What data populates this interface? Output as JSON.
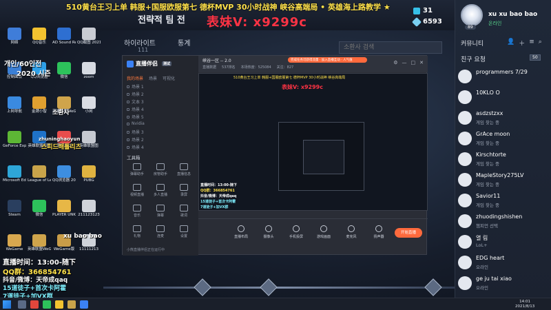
{
  "banner": {
    "text": "510黄台王习上单 韩服+国服欧服第七 德杯MVP 30小时战神 峡谷高端局 • 英雄海上路教学 ★",
    "sub": "전략적 팀 전",
    "watermark": "表妹V: x9299c",
    "stat_top": "31",
    "stat_bottom": "6593"
  },
  "game_nav": {
    "item1": "하이라이트",
    "item1_sub": "111",
    "item2": "통계"
  },
  "search": {
    "placeholder": "소환사 검색"
  },
  "desktop_icons": [
    {
      "label": "网络",
      "color": "#3f7dd9"
    },
    {
      "label": "QQ音乐",
      "color": "#f2c230"
    },
    {
      "label": "AD Sound Recorder",
      "color": "#2e6fd1"
    },
    {
      "label": "QQ截图 202108062...",
      "color": "#c9ccd3"
    },
    {
      "label": "控制面板",
      "color": "#3b7fd5"
    },
    {
      "label": "QQ浏览器",
      "color": "#2ea0e8"
    },
    {
      "label": "微信",
      "color": "#2dc25b"
    },
    {
      "label": "zoom",
      "color": "#d6dae2"
    },
    {
      "label": "上网导航",
      "color": "#3a8ae0"
    },
    {
      "label": "金牌小智",
      "color": "#e0a030"
    },
    {
      "label": "英雄联盟WeGame",
      "color": "#cfa44b"
    },
    {
      "label": "小闲",
      "color": "#d9dce3"
    },
    {
      "label": "GeForce Experience",
      "color": "#5db735"
    },
    {
      "label": "英雄联盟原图",
      "color": "#1f72c8"
    },
    {
      "label": "腾讯QQ",
      "color": "#e84d4d"
    },
    {
      "label": "英雄联盟图",
      "color": "#c5c9d1"
    },
    {
      "label": "Microsoft Edge",
      "color": "#2ea6d8"
    },
    {
      "label": "League of Legends",
      "color": "#c9a44a"
    },
    {
      "label": "QQ浏览器 2021071...",
      "color": "#3d8ee0"
    },
    {
      "label": "PUBG",
      "color": "#e0b340"
    },
    {
      "label": "Steam",
      "color": "#2a3f5f"
    },
    {
      "label": "微信",
      "color": "#2dc25b"
    },
    {
      "label": "PLAYER UNKNOWN'S BATTLEGR...",
      "color": "#e7b746"
    },
    {
      "label": "211123123",
      "color": "#cfd3da"
    },
    {
      "label": "WeGame",
      "color": "#d8a84f"
    },
    {
      "label": "英雄联盟WeGame版",
      "color": "#cfa44b"
    },
    {
      "label": "WeGame版",
      "color": "#c99d48"
    },
    {
      "label": "11111213",
      "color": "#cfd3da"
    }
  ],
  "overlay": {
    "line1": "개인/60인전",
    "line1_sub": "2020 시즌",
    "line2": "스피드배틀리츠",
    "line3": "소환사",
    "line4": "zhuninghaoyun",
    "line5": "xu bao bao",
    "live_time": "直播时间：13:00-随下",
    "qq_group": "QQ群：366854761",
    "douyin": "抖音/微博：天帝成qaq",
    "coach1": "15道徒子+首次卡阿霍",
    "coach2": "7道徒子+加VX群"
  },
  "profile": {
    "name": "xu xu bao bao",
    "status": "온라인",
    "level": "89"
  },
  "friends_panel": {
    "title": "커뮤니티",
    "section": "친구 요청",
    "count": "50",
    "friends": [
      {
        "name": "programmers 7/29",
        "status": ""
      },
      {
        "name": "10KLO O",
        "status": ""
      },
      {
        "name": "asdzstzxx",
        "status": "게임 찾는 중"
      },
      {
        "name": "GrAce moon",
        "status": "게임 찾는 중"
      },
      {
        "name": "Kirschtorte",
        "status": "게임 찾는 중"
      },
      {
        "name": "MapleStory275LV",
        "status": "게임 찾는 중"
      },
      {
        "name": "Savior11",
        "status": "게임 찾는 중"
      },
      {
        "name": "zhuodingshishen",
        "status": "챔피언 선택"
      },
      {
        "name": "열 림",
        "status": "LoL+"
      },
      {
        "name": "EDG heart",
        "status": "오라인"
      },
      {
        "name": "ge ju tai xiao",
        "status": "오라인"
      }
    ]
  },
  "app": {
    "logo": "直播伴侣",
    "logo_tag": "测试",
    "side_tabs": [
      "我的场景",
      "场景",
      "可视化"
    ],
    "scenes": [
      "场景 1",
      "场景 2",
      "文本 3",
      "场景 4",
      "场景 5",
      "Nvidia",
      "场景 3",
      "场景 2",
      "场景 4"
    ],
    "tools_title": "工具箱",
    "tools": [
      {
        "label": "弹幕助手"
      },
      {
        "label": "房管助手"
      },
      {
        "label": "直播信息"
      },
      {
        "label": "视频直播"
      },
      {
        "label": "多人直播"
      },
      {
        "label": "录屏"
      },
      {
        "label": "音乐"
      },
      {
        "label": "弹幕"
      },
      {
        "label": "歌词"
      },
      {
        "label": "礼物"
      },
      {
        "label": "连麦"
      },
      {
        "label": "设置"
      }
    ],
    "title": "峡谷一区 -- 2.0",
    "meta": [
      "直播数据",
      "537排名",
      "本场热度：525084",
      "关注：827"
    ],
    "pill": "完成任务可获得流量 · 加入直播互动 · 人气值",
    "controls": [
      {
        "label": "直播布局"
      },
      {
        "label": "摄像头"
      },
      {
        "label": "手机投屏"
      },
      {
        "label": "游戏画面"
      },
      {
        "label": "麦克风"
      },
      {
        "label": "扬声器"
      }
    ],
    "start_label": "开始直播",
    "footer": "小熊直播伴侣正在运行中"
  },
  "preview": {
    "banner": "510黄台王习上单 韩服+国服欧服第七 德杯MVP 30小时战神 峡谷高端局",
    "watermark": "表妹V: x9299c"
  },
  "taskbar": {
    "time": "14:01",
    "date": "2021/8/13"
  }
}
